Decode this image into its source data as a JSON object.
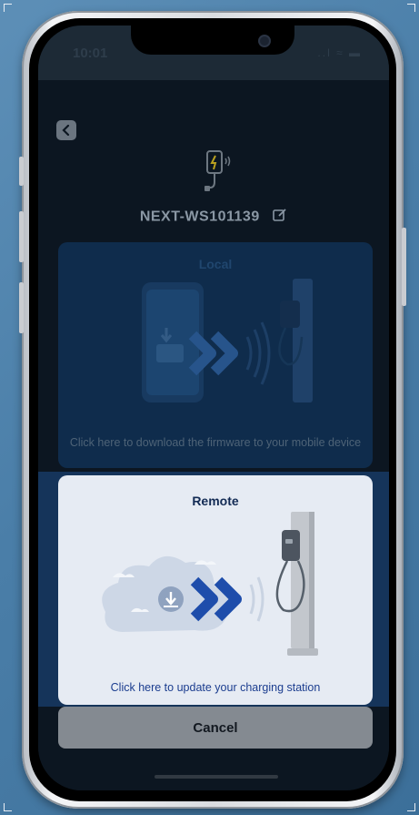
{
  "status_bar": {
    "time": "10:01",
    "icons_text": "..l  ≈  ▬"
  },
  "header": {
    "back_icon": "chevron-left-icon",
    "device_icon": "charger-wifi-icon",
    "device_name": "NEXT-WS101139",
    "edit_icon": "edit-icon"
  },
  "local_option": {
    "title": "Local",
    "caption": "Click here to download the firmware to your mobile device"
  },
  "remote_option": {
    "title": "Remote",
    "caption": "Click here to update your charging station"
  },
  "cancel_label": "Cancel",
  "colors": {
    "accent_blue": "#1e4dab",
    "card_light": "#e6ebf3",
    "overlay_dark": "#0c1621"
  }
}
